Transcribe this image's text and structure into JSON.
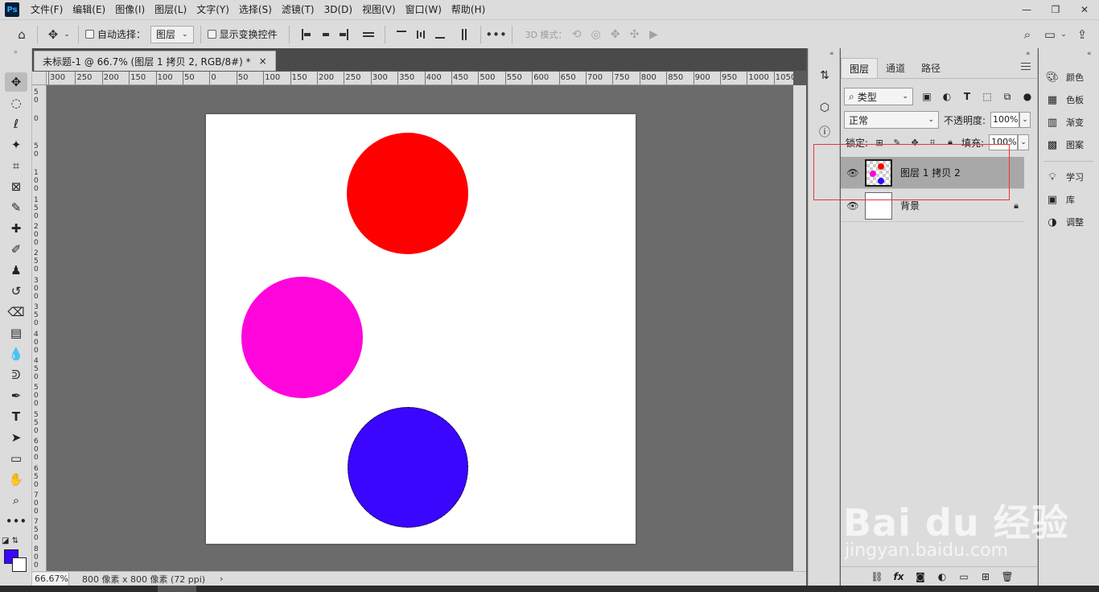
{
  "menubar": {
    "logo": "Ps",
    "items": [
      "文件(F)",
      "编辑(E)",
      "图像(I)",
      "图层(L)",
      "文字(Y)",
      "选择(S)",
      "滤镜(T)",
      "3D(D)",
      "视图(V)",
      "窗口(W)",
      "帮助(H)"
    ]
  },
  "optionsbar": {
    "auto_select_label": "自动选择：",
    "auto_select_target": "图层",
    "show_transform_label": "显示变换控件",
    "mode_3d_label": "3D 模式："
  },
  "document": {
    "tab_title": "未标题-1 @ 66.7% (图层 1 拷贝 2, RGB/8#) *",
    "tab_close": "×"
  },
  "ruler": {
    "top_labels": [
      "300",
      "250",
      "200",
      "150",
      "100",
      "50",
      "0",
      "50",
      "100",
      "150",
      "200",
      "250",
      "300",
      "350",
      "400",
      "450",
      "500",
      "550",
      "600",
      "650",
      "700",
      "750",
      "800",
      "850",
      "900",
      "950",
      "1000",
      "1050"
    ],
    "left_labels": [
      "50",
      "0",
      "50",
      "100",
      "150",
      "200",
      "250",
      "300",
      "350",
      "400",
      "450",
      "500",
      "550",
      "600",
      "650",
      "700",
      "750",
      "800"
    ]
  },
  "canvas": {
    "circles": [
      {
        "name": "red-circle",
        "color": "#fe0000"
      },
      {
        "name": "magenta-circle",
        "color": "#fe05dc"
      },
      {
        "name": "blue-circle",
        "color": "#3a06fe"
      }
    ]
  },
  "statusbar": {
    "zoom": "66.67%",
    "doc_info": "800 像素 x 800 像素 (72 ppi)",
    "arrow": "›"
  },
  "colors": {
    "foreground": "#3a06fe",
    "background": "#ffffff"
  },
  "layers_panel": {
    "tabs": [
      "图层",
      "通道",
      "路径"
    ],
    "filter_kind": "类型",
    "blend_mode": "正常",
    "opacity_label": "不透明度:",
    "opacity_value": "100%",
    "lock_label": "锁定:",
    "fill_label": "填充:",
    "fill_value": "100%",
    "layers": [
      {
        "name": "图层 1 拷贝 2",
        "selected": true
      },
      {
        "name": "背景",
        "selected": false,
        "locked": true
      }
    ]
  },
  "right_dock": {
    "items": [
      "颜色",
      "色板",
      "渐变",
      "图案",
      "学习",
      "库",
      "调整"
    ]
  },
  "watermark": {
    "brand": "Bai du 经验",
    "url": "jingyan.baidu.com"
  }
}
